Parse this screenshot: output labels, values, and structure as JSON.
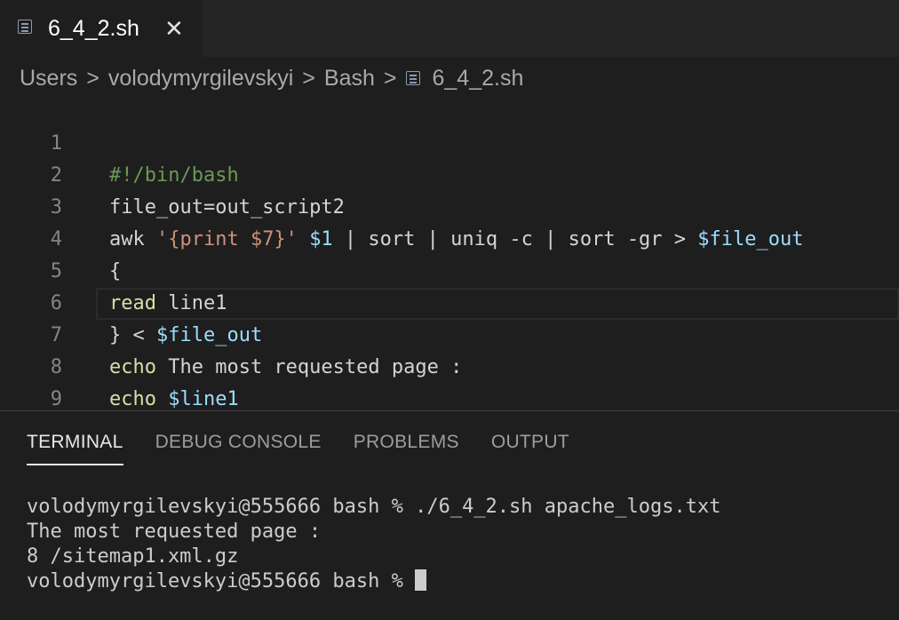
{
  "tab": {
    "label": "6_4_2.sh",
    "close": "✕"
  },
  "breadcrumb": {
    "items": [
      "Users",
      "volodymyrgilevskyi",
      "Bash",
      "6_4_2.sh"
    ],
    "separator": ">"
  },
  "editor": {
    "line_numbers": [
      "1",
      "2",
      "3",
      "4",
      "5",
      "6",
      "7",
      "8",
      "9"
    ],
    "lines": {
      "l1": {
        "comment": "#!/bin/bash"
      },
      "l2": {
        "text": "file_out=out_script2"
      },
      "l3": {
        "cmd": "awk ",
        "str": "'{print $7}'",
        "sp": " ",
        "arg": "$1",
        "rest": " | sort | uniq -c | sort -gr > ",
        "var": "$file_out"
      },
      "l4": {
        "text": "{"
      },
      "l5": {
        "kw": "read",
        "rest": " line1"
      },
      "l6": {
        "pre": "} < ",
        "var": "$file_out"
      },
      "l7": {
        "kw": "echo",
        "rest": " The most requested page :"
      },
      "l8": {
        "kw": "echo",
        "sp": " ",
        "var": "$line1"
      }
    }
  },
  "panel": {
    "tabs": [
      "TERMINAL",
      "DEBUG CONSOLE",
      "PROBLEMS",
      "OUTPUT"
    ]
  },
  "terminal": {
    "lines": [
      "volodymyrgilevskyi@555666 bash % ./6_4_2.sh apache_logs.txt",
      "The most requested page :",
      "8 /sitemap1.xml.gz",
      "volodymyrgilevskyi@555666 bash % "
    ]
  }
}
